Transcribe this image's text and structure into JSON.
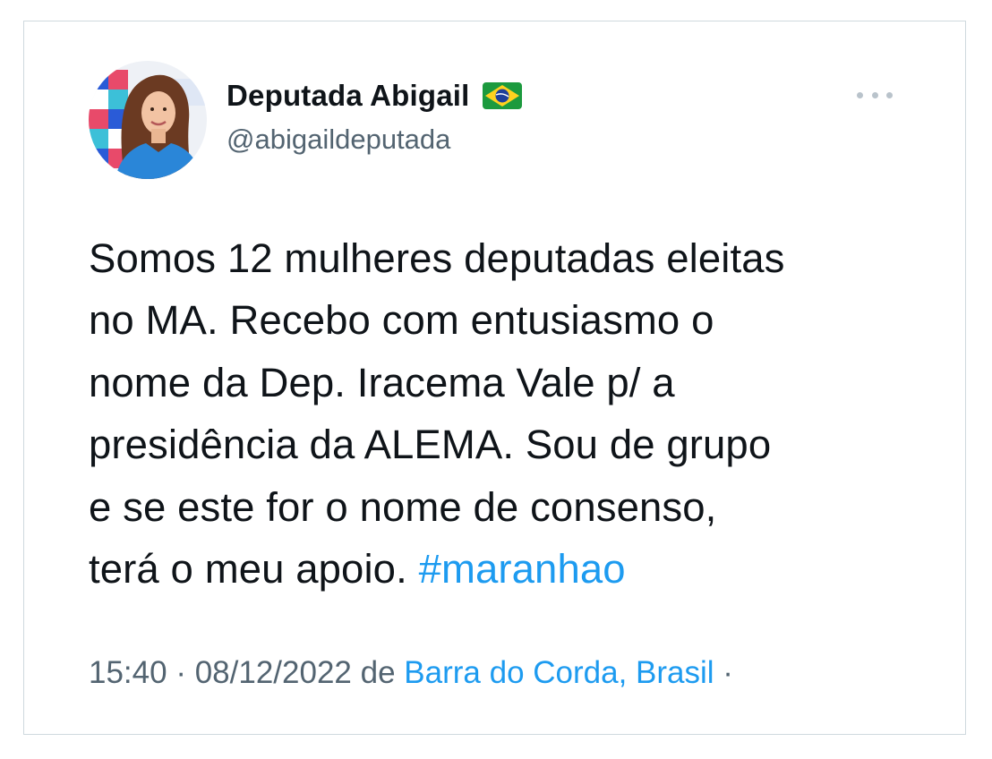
{
  "tweet": {
    "author": {
      "display_name": "Deputada Abigail",
      "flag_icon": "brazil-flag-icon",
      "handle": "@abigaildeputada"
    },
    "menu_icon": "more-options-icon",
    "text_lines": [
      "Somos 12 mulheres deputadas eleitas",
      "no MA. Recebo com entusiasmo o",
      "nome da Dep. Iracema Vale p/ a",
      "presidência da ALEMA. Sou de grupo",
      "e se este for o nome de consenso,",
      "terá o meu apoio."
    ],
    "hashtag": "#maranhao",
    "time": "15:40",
    "separator": "·",
    "date": "08/12/2022",
    "source_prefix": "de",
    "location": "Barra do Corda, Brasil",
    "trailing_separator": "·"
  },
  "colors": {
    "text": "#0f1419",
    "secondary": "#536471",
    "link": "#1d9bf0",
    "border": "#cfd9de"
  }
}
